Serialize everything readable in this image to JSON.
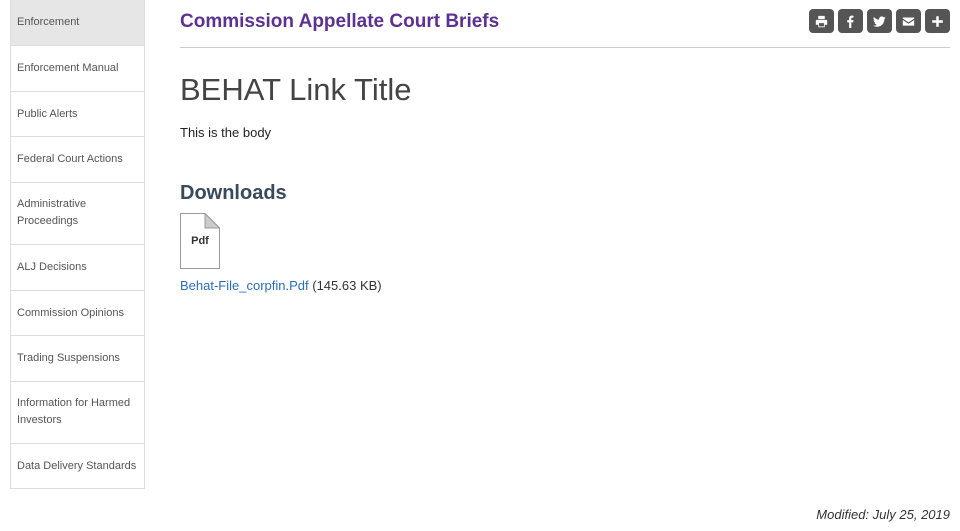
{
  "sidebar": {
    "items": [
      {
        "label": "Enforcement"
      },
      {
        "label": "Enforcement Manual"
      },
      {
        "label": "Public Alerts"
      },
      {
        "label": "Federal Court Actions"
      },
      {
        "label": "Administrative Proceedings"
      },
      {
        "label": "ALJ Decisions"
      },
      {
        "label": "Commission Opinions"
      },
      {
        "label": "Trading Suspensions"
      },
      {
        "label": "Information for Harmed Investors"
      },
      {
        "label": "Data Delivery Standards"
      }
    ]
  },
  "header": {
    "title": "Commission Appellate Court Briefs",
    "share_icons": [
      "print-icon",
      "facebook-icon",
      "twitter-icon",
      "email-icon",
      "plus-icon"
    ]
  },
  "content": {
    "link_title": "BEHAT Link Title",
    "body": "This is the body",
    "downloads_heading": "Downloads",
    "file": {
      "icon_label": "Pdf",
      "name": "Behat-File_corpfin.Pdf",
      "size": "(145.63 KB)"
    }
  },
  "footer": {
    "modified": "Modified: July 25, 2019"
  },
  "colors": {
    "title": "#5c3192",
    "link": "#2a6ebb",
    "share_button": "#555555"
  }
}
